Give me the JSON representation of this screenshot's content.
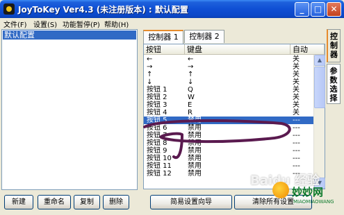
{
  "window": {
    "title": "JoyToKey Ver4.3 (未注册版本) : 默认配置"
  },
  "menu": {
    "items": [
      "文件(F)",
      "设置(S)",
      "功能暂停(P)",
      "帮助(H)"
    ]
  },
  "profiles": {
    "items": [
      "默认配置"
    ],
    "selected": "默认配置"
  },
  "left_buttons": {
    "new": "新建",
    "rename": "重命名",
    "copy": "复制",
    "delete": "删除"
  },
  "tabs": [
    "控制器 1",
    "控制器 2"
  ],
  "side_tabs": [
    "控制器",
    "参数选择"
  ],
  "table": {
    "columns": [
      "按钮",
      "键盘",
      "自动"
    ],
    "rows": [
      [
        "←",
        "←",
        "关"
      ],
      [
        "→",
        "→",
        "关"
      ],
      [
        "↑",
        "↑",
        "关"
      ],
      [
        "↓",
        "↓",
        "关"
      ],
      [
        "按钮 1",
        "Q",
        "关"
      ],
      [
        "按钮 2",
        "W",
        "关"
      ],
      [
        "按钮 3",
        "E",
        "关"
      ],
      [
        "按钮 4",
        "R",
        "关"
      ],
      [
        "按钮 5",
        "禁用",
        "---"
      ],
      [
        "按钮 6",
        "禁用",
        "---"
      ],
      [
        "按钮 7",
        "禁用",
        "---"
      ],
      [
        "按钮 8",
        "禁用",
        "---"
      ],
      [
        "按钮 9",
        "禁用",
        "---"
      ],
      [
        "按钮 10",
        "禁用",
        "---"
      ],
      [
        "按钮 11",
        "禁用",
        "---"
      ],
      [
        "按钮 12",
        "禁用",
        "---"
      ]
    ],
    "selected_row": 8
  },
  "bottom_buttons": {
    "wizard": "简易设置向导",
    "clear": "清除所有设置"
  },
  "overlay": {
    "watermark": "Baidu 经验",
    "brand_name": "妙妙网",
    "brand_sub": "MIAOMIAOWANG"
  },
  "colors": {
    "titlebar": "#0b47c7",
    "selection": "#316ac5",
    "annotation": "#5a1a4f"
  }
}
